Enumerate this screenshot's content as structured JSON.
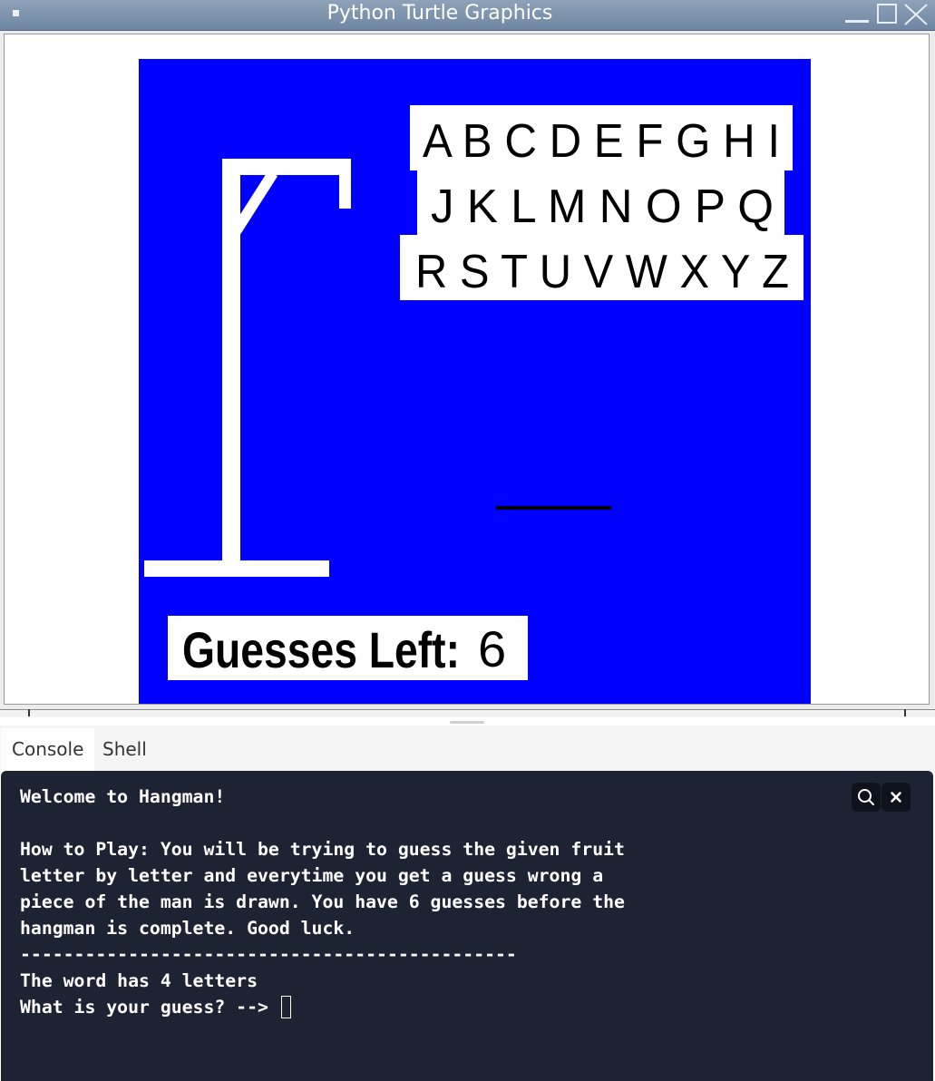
{
  "window": {
    "title": "Python Turtle Graphics"
  },
  "colors": {
    "game_background": "#0000ff",
    "drawing": "#ffffff",
    "console_background": "#1d2333"
  },
  "game": {
    "letter_rows": [
      "A B C D E F G H I",
      "J K L M N O P Q",
      "R S T U V W X Y Z"
    ],
    "guesses_left_label": "Guesses Left:",
    "guesses_left_value": "6",
    "word_blanks": 1
  },
  "tabs": [
    {
      "label": "Console",
      "active": true
    },
    {
      "label": "Shell",
      "active": false
    }
  ],
  "console": {
    "lines": [
      "Welcome to Hangman!",
      "",
      "How to Play: You will be trying to guess the given fruit",
      "letter by letter and everytime you get a guess wrong a",
      "piece of the man is drawn. You have 6 guesses before the",
      "hangman is complete. Good luck.",
      "----------------------------------------------",
      "The word has 4 letters"
    ],
    "prompt": "What is your guess? --> ",
    "search_icon": "search-icon",
    "close_icon": "close-icon"
  }
}
